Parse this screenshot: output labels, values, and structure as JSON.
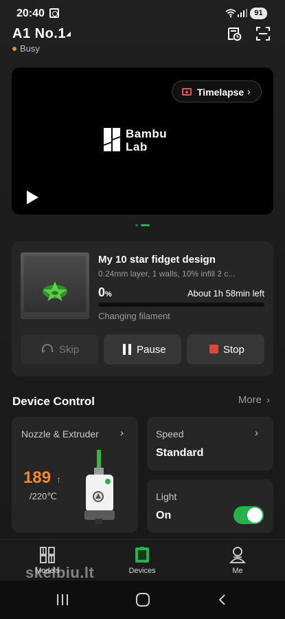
{
  "status_bar": {
    "time": "20:40",
    "battery": "91"
  },
  "header": {
    "device_name": "A1 No.1",
    "status": "Busy",
    "status_color": "#f08a30"
  },
  "camera": {
    "timelapse_label": "Timelapse",
    "logo_line1": "Bambu",
    "logo_line2": "Lab",
    "pages": 2,
    "active_page": 2
  },
  "print_job": {
    "title": "My 10 star fidget design",
    "details": "0.24mm layer, 1 walls, 10% infill 2 c...",
    "progress_value": "0",
    "progress_unit": "%",
    "progress": 0,
    "time_left": "About 1h 58min left",
    "stage": "Changing filament",
    "buttons": {
      "skip": "Skip",
      "pause": "Pause",
      "stop": "Stop"
    }
  },
  "device_control": {
    "title": "Device Control",
    "more": "More",
    "nozzle": {
      "label": "Nozzle & Extruder",
      "current_temp": "189",
      "target_temp": "/220℃"
    },
    "speed": {
      "label": "Speed",
      "value": "Standard"
    },
    "light": {
      "label": "Light",
      "value": "On",
      "enabled": true
    }
  },
  "nav": {
    "models": "Models",
    "devices": "Devices",
    "me": "Me",
    "active": "devices"
  },
  "watermark": "skelbiu.lt",
  "colors": {
    "accent": "#27b04f",
    "temperature": "#f08a30",
    "stop": "#e0453c"
  }
}
